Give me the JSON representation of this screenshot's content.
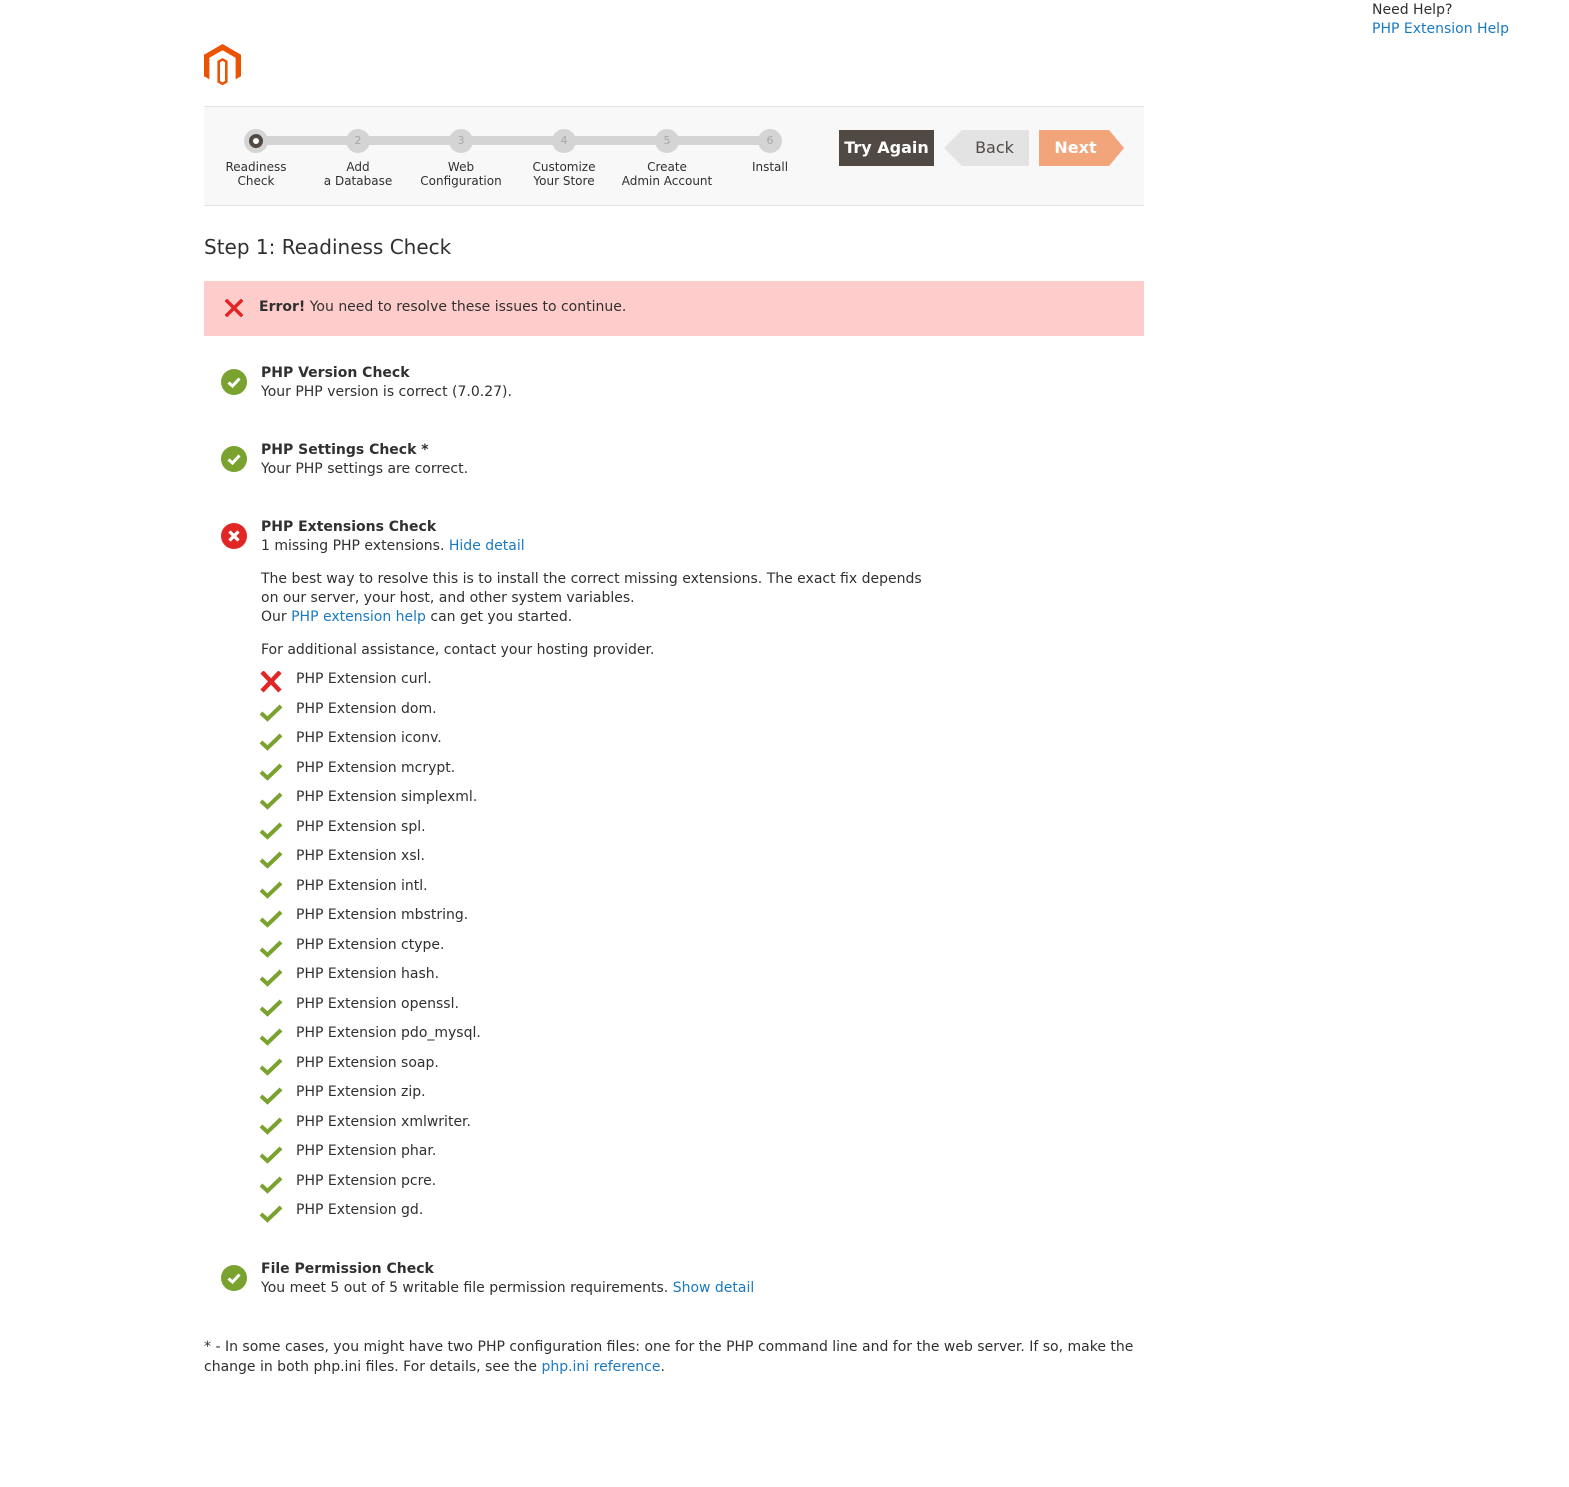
{
  "help": {
    "question": "Need Help?",
    "link": "PHP Extension Help"
  },
  "logo": {
    "name": "Magento",
    "color": "#eb5202"
  },
  "wizard": {
    "steps": [
      {
        "number": "1",
        "line1": "Readiness",
        "line2": "Check",
        "active": true
      },
      {
        "number": "2",
        "line1": "Add",
        "line2": "a Database",
        "active": false
      },
      {
        "number": "3",
        "line1": "Web",
        "line2": "Configuration",
        "active": false
      },
      {
        "number": "4",
        "line1": "Customize",
        "line2": "Your Store",
        "active": false
      },
      {
        "number": "5",
        "line1": "Create",
        "line2": "Admin Account",
        "active": false
      },
      {
        "number": "6",
        "line1": "Install",
        "line2": "",
        "active": false
      }
    ],
    "buttons": {
      "try_again": "Try Again",
      "back": "Back",
      "next": "Next"
    }
  },
  "page_title": "Step 1: Readiness Check",
  "error": {
    "strong": "Error!",
    "message": " You need to resolve these issues to continue."
  },
  "checks": {
    "php_version": {
      "title": "PHP Version Check",
      "desc": "Your PHP version is correct (7.0.27).",
      "status": "ok"
    },
    "php_settings": {
      "title": "PHP Settings Check *",
      "desc": "Your PHP settings are correct.",
      "status": "ok"
    },
    "php_extensions": {
      "title": "PHP Extensions Check",
      "desc": "1 missing PHP extensions. ",
      "toggle_link": "Hide detail",
      "status": "error",
      "detail": {
        "para1": "The best way to resolve this is to install the correct missing extensions. The exact fix depends on our server, your host, and other system variables.",
        "para2_prefix": "Our ",
        "para2_link": "PHP extension help",
        "para2_suffix": " can get you started.",
        "para3": "For additional assistance, contact your hosting provider."
      },
      "extensions": [
        {
          "label": "PHP Extension curl.",
          "status": "missing"
        },
        {
          "label": "PHP Extension dom.",
          "status": "ok"
        },
        {
          "label": "PHP Extension iconv.",
          "status": "ok"
        },
        {
          "label": "PHP Extension mcrypt.",
          "status": "ok"
        },
        {
          "label": "PHP Extension simplexml.",
          "status": "ok"
        },
        {
          "label": "PHP Extension spl.",
          "status": "ok"
        },
        {
          "label": "PHP Extension xsl.",
          "status": "ok"
        },
        {
          "label": "PHP Extension intl.",
          "status": "ok"
        },
        {
          "label": "PHP Extension mbstring.",
          "status": "ok"
        },
        {
          "label": "PHP Extension ctype.",
          "status": "ok"
        },
        {
          "label": "PHP Extension hash.",
          "status": "ok"
        },
        {
          "label": "PHP Extension openssl.",
          "status": "ok"
        },
        {
          "label": "PHP Extension pdo_mysql.",
          "status": "ok"
        },
        {
          "label": "PHP Extension soap.",
          "status": "ok"
        },
        {
          "label": "PHP Extension zip.",
          "status": "ok"
        },
        {
          "label": "PHP Extension xmlwriter.",
          "status": "ok"
        },
        {
          "label": "PHP Extension phar.",
          "status": "ok"
        },
        {
          "label": "PHP Extension pcre.",
          "status": "ok"
        },
        {
          "label": "PHP Extension gd.",
          "status": "ok"
        }
      ]
    },
    "file_permission": {
      "title": "File Permission Check",
      "desc": "You meet 5 out of 5 writable file permission requirements. ",
      "toggle_link": "Show detail",
      "status": "ok"
    }
  },
  "footnote": {
    "text": "* - In some cases, you might have two PHP configuration files: one for the PHP command line and for the web server. If so, make the change in both php.ini files. For details, see the ",
    "link": "php.ini reference",
    "suffix": "."
  },
  "colors": {
    "ok": "#79a22e",
    "error": "#e22626",
    "link": "#1979c3",
    "error_bg": "#ffcccc",
    "try_again_bg": "#514943",
    "next_bg": "#f2a57a"
  }
}
